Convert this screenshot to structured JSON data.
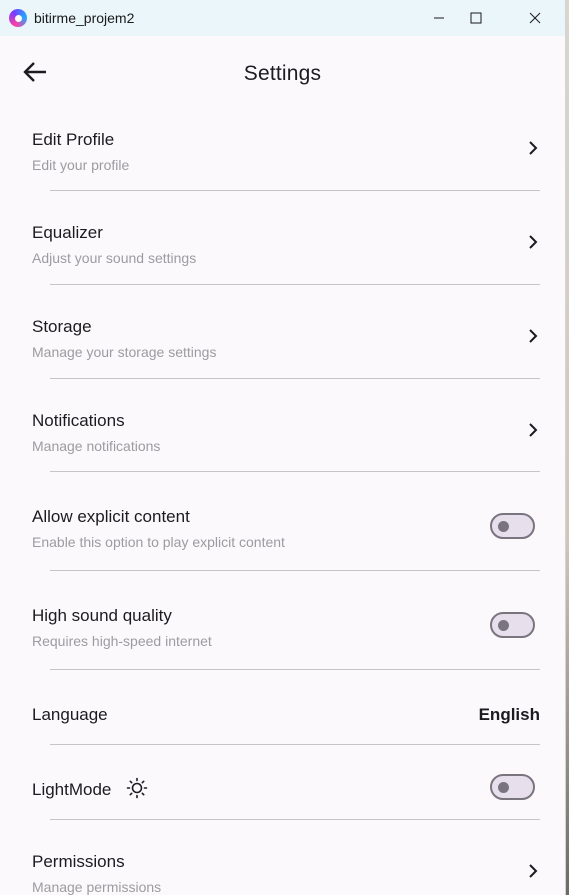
{
  "window": {
    "title": "bitirme_projem2",
    "minimize": "—",
    "maximize": "☐",
    "close": "✕"
  },
  "appbar": {
    "title": "Settings"
  },
  "items": [
    {
      "title": "Edit Profile",
      "subtitle": "Edit your profile",
      "type": "chevron"
    },
    {
      "title": "Equalizer",
      "subtitle": "Adjust your sound settings",
      "type": "chevron"
    },
    {
      "title": "Storage",
      "subtitle": "Manage your storage settings",
      "type": "chevron"
    },
    {
      "title": "Notifications",
      "subtitle": "Manage notifications",
      "type": "chevron"
    },
    {
      "title": "Allow explicit content",
      "subtitle": "Enable this option to play explicit content",
      "type": "toggle",
      "on": false
    },
    {
      "title": "High sound quality",
      "subtitle": "Requires high-speed internet",
      "type": "toggle",
      "on": false
    },
    {
      "title": "Language",
      "value": "English",
      "type": "value"
    },
    {
      "title": "LightMode",
      "icon": "sun-icon",
      "type": "toggle",
      "on": false
    },
    {
      "title": "Permissions",
      "subtitle": "Manage permissions",
      "type": "chevron"
    }
  ],
  "colors": {
    "titlebar": "#eaf6fa",
    "background": "#fbf9fb",
    "toggle_track": "#e7e0ec",
    "toggle_border": "#79747e"
  }
}
